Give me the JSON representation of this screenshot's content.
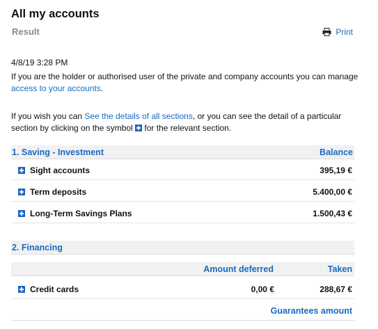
{
  "header": {
    "title": "All my accounts",
    "subtitle": "Result",
    "print_label": "Print"
  },
  "timestamp": "4/8/19 3:28 PM",
  "intro": {
    "line1_text": "If you are the holder or authorised user of the private and company accounts you can manage ",
    "line1_link": "access to your accounts",
    "line1_end": ".",
    "line2_start": "If you wish you can ",
    "line2_link": "See the details of all sections",
    "line2_mid": ", or you can see the detail of a particular section by clicking on the symbol ",
    "line2_end": " for the relevant section."
  },
  "saving": {
    "title": "1. Saving - Investment",
    "column_label": "Balance",
    "rows": [
      {
        "name": "Sight accounts",
        "value": "395,19 €"
      },
      {
        "name": "Term deposits",
        "value": "5.400,00 €"
      },
      {
        "name": "Long-Term Savings Plans",
        "value": "1.500,43 €"
      }
    ]
  },
  "financing": {
    "title": "2. Financing",
    "col_deferred": "Amount deferred",
    "col_taken": "Taken",
    "rows": [
      {
        "name": "Credit cards",
        "deferred": "0,00 €",
        "taken": "288,67 €"
      }
    ],
    "guarantees_label": "Guarantees amount"
  },
  "colors": {
    "accent": "#1a6ac0",
    "plus_icon": "#1f63c6",
    "subtitle_gray": "#8a8a8a",
    "section_bg": "#f1f1f1"
  },
  "icons": {
    "print": "printer-icon",
    "expand": "plus-square-icon"
  }
}
